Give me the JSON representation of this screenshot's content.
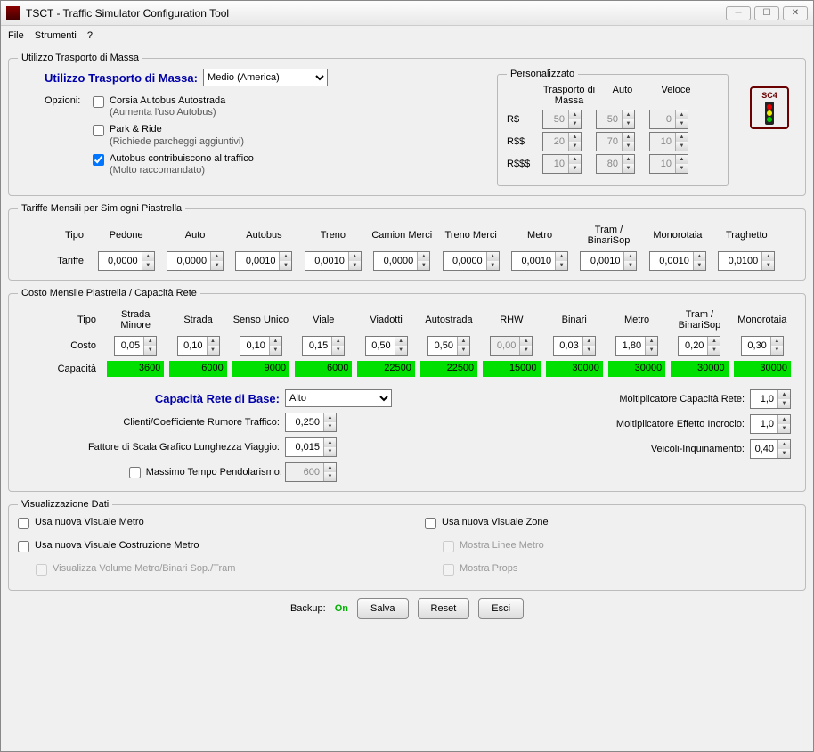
{
  "window": {
    "title": "TSCT - Traffic Simulator Configuration Tool"
  },
  "menu": {
    "file": "File",
    "tools": "Strumenti",
    "help": "?"
  },
  "winbtns": {
    "min": "─",
    "max": "☐",
    "close": "✕"
  },
  "mass": {
    "legend": "Utilizzo Trasporto di Massa",
    "heading": "Utilizzo Trasporto di Massa:",
    "select_value": "Medio (America)",
    "options_label": "Opzioni:",
    "opt1": {
      "label": "Corsia Autobus Autostrada",
      "sub": "(Aumenta l'uso Autobus)",
      "checked": false
    },
    "opt2": {
      "label": "Park & Ride",
      "sub": "(Richiede parcheggi aggiuntivi)",
      "checked": false
    },
    "opt3": {
      "label": "Autobus contribuiscono al traffico",
      "sub": "(Molto raccomandato)",
      "checked": true
    },
    "custom": {
      "legend": "Personalizzato",
      "cols": {
        "mass": "Trasporto di Massa",
        "auto": "Auto",
        "speed": "Veloce"
      },
      "rows": [
        {
          "k": "R$",
          "mass": "50",
          "auto": "50",
          "speed": "0"
        },
        {
          "k": "R$$",
          "mass": "20",
          "auto": "70",
          "speed": "10"
        },
        {
          "k": "R$$$",
          "mass": "10",
          "auto": "80",
          "speed": "10"
        }
      ]
    },
    "logo": "SC4"
  },
  "fares": {
    "legend": "Tariffe Mensili per Sim ogni Piastrella",
    "type_label": "Tipo",
    "row_label": "Tariffe",
    "headers": [
      "Pedone",
      "Auto",
      "Autobus",
      "Treno",
      "Camion Merci",
      "Treno Merci",
      "Metro",
      "Tram / BinariSop",
      "Monorotaia",
      "Traghetto"
    ],
    "values": [
      "0,0000",
      "0,0000",
      "0,0010",
      "0,0010",
      "0,0000",
      "0,0000",
      "0,0010",
      "0,0010",
      "0,0010",
      "0,0100"
    ]
  },
  "costs": {
    "legend": "Costo Mensile Piastrella / Capacità Rete",
    "type_label": "Tipo",
    "cost_label": "Costo",
    "cap_label": "Capacità",
    "headers": [
      "Strada Minore",
      "Strada",
      "Senso Unico",
      "Viale",
      "Viadotti",
      "Autostrada",
      "RHW",
      "Binari",
      "Metro",
      "Tram / BinariSop",
      "Monorotaia"
    ],
    "cost_values": [
      "0,05",
      "0,10",
      "0,10",
      "0,15",
      "0,50",
      "0,50",
      "0,00",
      "0,03",
      "1,80",
      "0,20",
      "0,30"
    ],
    "cost_disabled_index": 6,
    "cap_values": [
      "3600",
      "6000",
      "9000",
      "6000",
      "22500",
      "22500",
      "15000",
      "30000",
      "30000",
      "30000",
      "30000"
    ],
    "basecap_label": "Capacità Rete di Base:",
    "basecap_value": "Alto",
    "noise_label": "Clienti/Coefficiente Rumore Traffico:",
    "noise_value": "0,250",
    "scale_label": "Fattore di Scala Grafico Lunghezza Viaggio:",
    "scale_value": "0,015",
    "commute_label": "Massimo Tempo Pendolarismo:",
    "commute_value": "600",
    "netmul_label": "Moltiplicatore Capacità Rete:",
    "netmul_value": "1,0",
    "intmul_label": "Moltiplicatore Effetto Incrocio:",
    "intmul_value": "1,0",
    "poll_label": "Veicoli-Inquinamento:",
    "poll_value": "0,40"
  },
  "dataviz": {
    "legend": "Visualizzazione Dati",
    "a": "Usa nuova Visuale Metro",
    "b": "Usa nuova Visuale Costruzione Metro",
    "c": "Visualizza Volume Metro/Binari Sop./Tram",
    "d": "Usa nuova Visuale Zone",
    "e": "Mostra Linee Metro",
    "f": "Mostra Props"
  },
  "footer": {
    "backup": "Backup:",
    "backup_state": "On",
    "save": "Salva",
    "reset": "Reset",
    "exit": "Esci"
  }
}
